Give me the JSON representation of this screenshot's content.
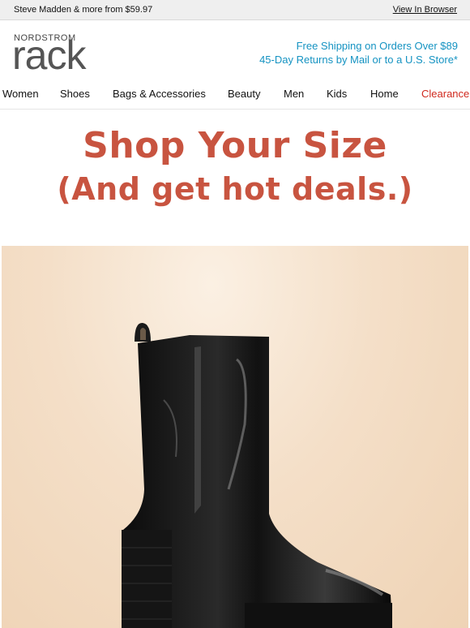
{
  "topbar": {
    "preheader": "Steve Madden & more from $59.97",
    "view_in_browser": "View In Browser"
  },
  "logo": {
    "top": "NORDSTROM",
    "main": "rack"
  },
  "promo": {
    "line1": "Free Shipping on Orders Over $89",
    "line2": "45-Day Returns by Mail or to a U.S. Store*"
  },
  "nav": {
    "items": [
      "Women",
      "Shoes",
      "Bags & Accessories",
      "Beauty",
      "Men",
      "Kids",
      "Home",
      "Clearance"
    ]
  },
  "hero": {
    "headline": "Shop Your Size",
    "subhead": "(And get hot deals.)"
  },
  "colors": {
    "promo_text": "#1593c2",
    "clearance": "#d0291e",
    "headline": "#c85440"
  }
}
